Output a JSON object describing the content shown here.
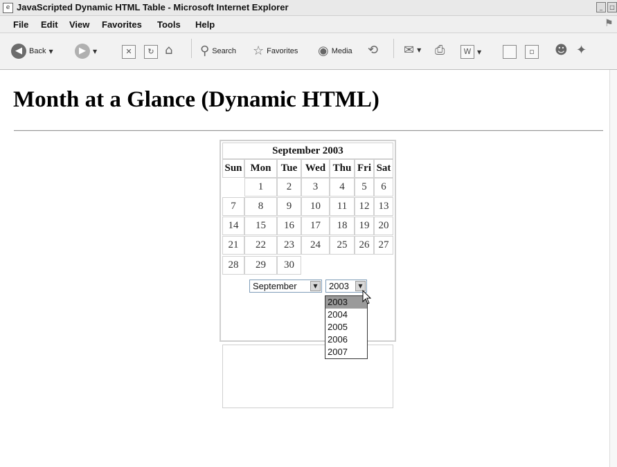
{
  "window": {
    "title": "JavaScripted Dynamic HTML Table - Microsoft Internet Explorer"
  },
  "menu": [
    "File",
    "Edit",
    "View",
    "Favorites",
    "Tools",
    "Help"
  ],
  "toolbar": {
    "back_label": "Back",
    "search_label": "Search",
    "favorites_label": "Favorites",
    "media_label": "Media"
  },
  "page": {
    "heading": "Month at a Glance (Dynamic HTML)"
  },
  "calendar": {
    "caption": "September 2003",
    "weekdays": [
      "Sun",
      "Mon",
      "Tue",
      "Wed",
      "Thu",
      "Fri",
      "Sat"
    ],
    "weeks": [
      [
        "",
        "1",
        "2",
        "3",
        "4",
        "5",
        "6"
      ],
      [
        "7",
        "8",
        "9",
        "10",
        "11",
        "12",
        "13"
      ],
      [
        "14",
        "15",
        "16",
        "17",
        "18",
        "19",
        "20"
      ],
      [
        "21",
        "22",
        "23",
        "24",
        "25",
        "26",
        "27"
      ],
      [
        "28",
        "29",
        "30",
        "",
        "",
        "",
        ""
      ]
    ]
  },
  "month_select": {
    "value": "September"
  },
  "year_select": {
    "value": "2003",
    "options": [
      "2003",
      "2004",
      "2005",
      "2006",
      "2007"
    ],
    "highlighted": "2003"
  }
}
